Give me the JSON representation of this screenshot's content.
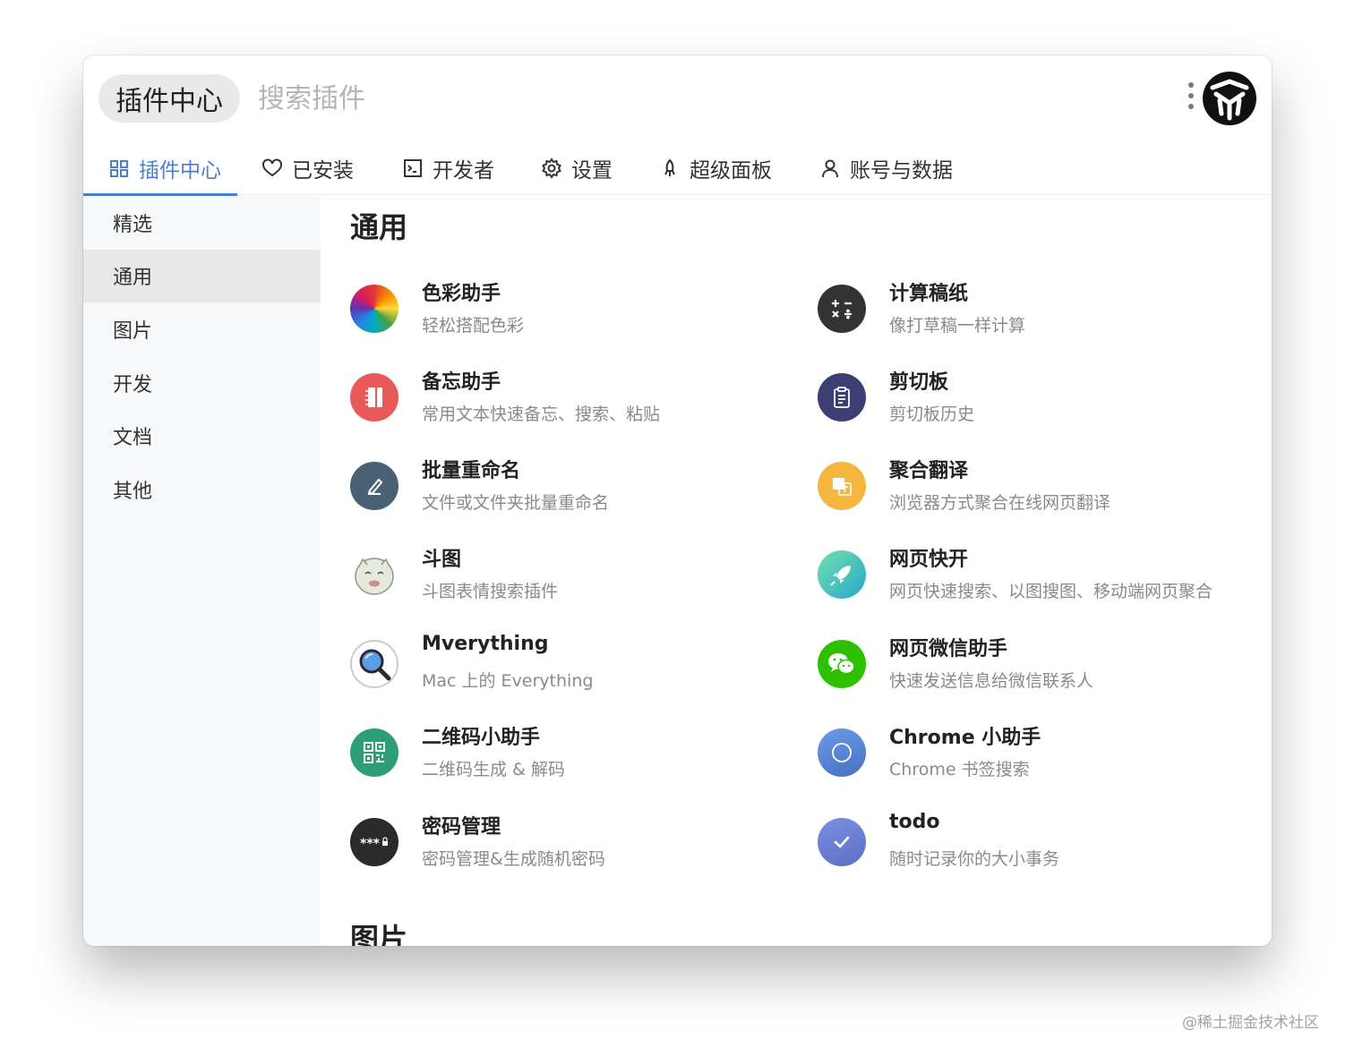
{
  "header": {
    "chip_label": "插件中心",
    "search_placeholder": "搜索插件"
  },
  "tabs": [
    {
      "label": "插件中心",
      "icon": "grid-icon",
      "active": true
    },
    {
      "label": "已安装",
      "icon": "heart-icon"
    },
    {
      "label": "开发者",
      "icon": "terminal-icon"
    },
    {
      "label": "设置",
      "icon": "gear-icon"
    },
    {
      "label": "超级面板",
      "icon": "rocket-icon"
    },
    {
      "label": "账号与数据",
      "icon": "user-icon"
    }
  ],
  "sidebar": {
    "items": [
      {
        "label": "精选"
      },
      {
        "label": "通用",
        "active": true
      },
      {
        "label": "图片"
      },
      {
        "label": "开发"
      },
      {
        "label": "文档"
      },
      {
        "label": "其他"
      }
    ]
  },
  "main": {
    "section_title": "通用",
    "next_section_title": "图片",
    "plugins": [
      {
        "name": "色彩助手",
        "desc": "轻松搭配色彩",
        "icon": "color-wheel-icon"
      },
      {
        "name": "计算稿纸",
        "desc": "像打草稿一样计算",
        "icon": "calculator-icon",
        "color": "#333333"
      },
      {
        "name": "备忘助手",
        "desc": "常用文本快速备忘、搜索、粘贴",
        "icon": "notebook-icon",
        "color": "#e85a5a"
      },
      {
        "name": "剪切板",
        "desc": "剪切板历史",
        "icon": "clipboard-icon",
        "color": "#3b3f74"
      },
      {
        "name": "批量重命名",
        "desc": "文件或文件夹批量重命名",
        "icon": "rename-icon",
        "color": "#4a6074"
      },
      {
        "name": "聚合翻译",
        "desc": "浏览器方式聚合在线网页翻译",
        "icon": "translate-icon",
        "color": "#f5b640"
      },
      {
        "name": "斗图",
        "desc": "斗图表情搜索插件",
        "icon": "meme-face-icon",
        "color": "#dfe6d8"
      },
      {
        "name": "网页快开",
        "desc": "网页快速搜索、以图搜图、移动端网页聚合",
        "icon": "rocket-icon",
        "color": "#3fc3b0"
      },
      {
        "name": "Mverything",
        "desc": "Mac 上的 Everything",
        "icon": "magnifier-icon",
        "color": "#ffffff"
      },
      {
        "name": "网页微信助手",
        "desc": "快速发送信息给微信联系人",
        "icon": "wechat-icon",
        "color": "#2dc100"
      },
      {
        "name": "二维码小助手",
        "desc": "二维码生成 & 解码",
        "icon": "qrcode-icon",
        "color": "#2e9e76"
      },
      {
        "name": "Chrome 小助手",
        "desc": "Chrome 书签搜索",
        "icon": "chrome-circle-icon",
        "color": "#5a86d6"
      },
      {
        "name": "密码管理",
        "desc": "密码管理&生成随机密码",
        "icon": "password-icon",
        "color": "#2b2b2b"
      },
      {
        "name": "todo",
        "desc": "随时记录你的大小事务",
        "icon": "check-icon",
        "color": "#6a7fd0"
      }
    ]
  },
  "watermark": "@稀土掘金技术社区",
  "colors": {
    "accent": "#4a7fcf"
  }
}
